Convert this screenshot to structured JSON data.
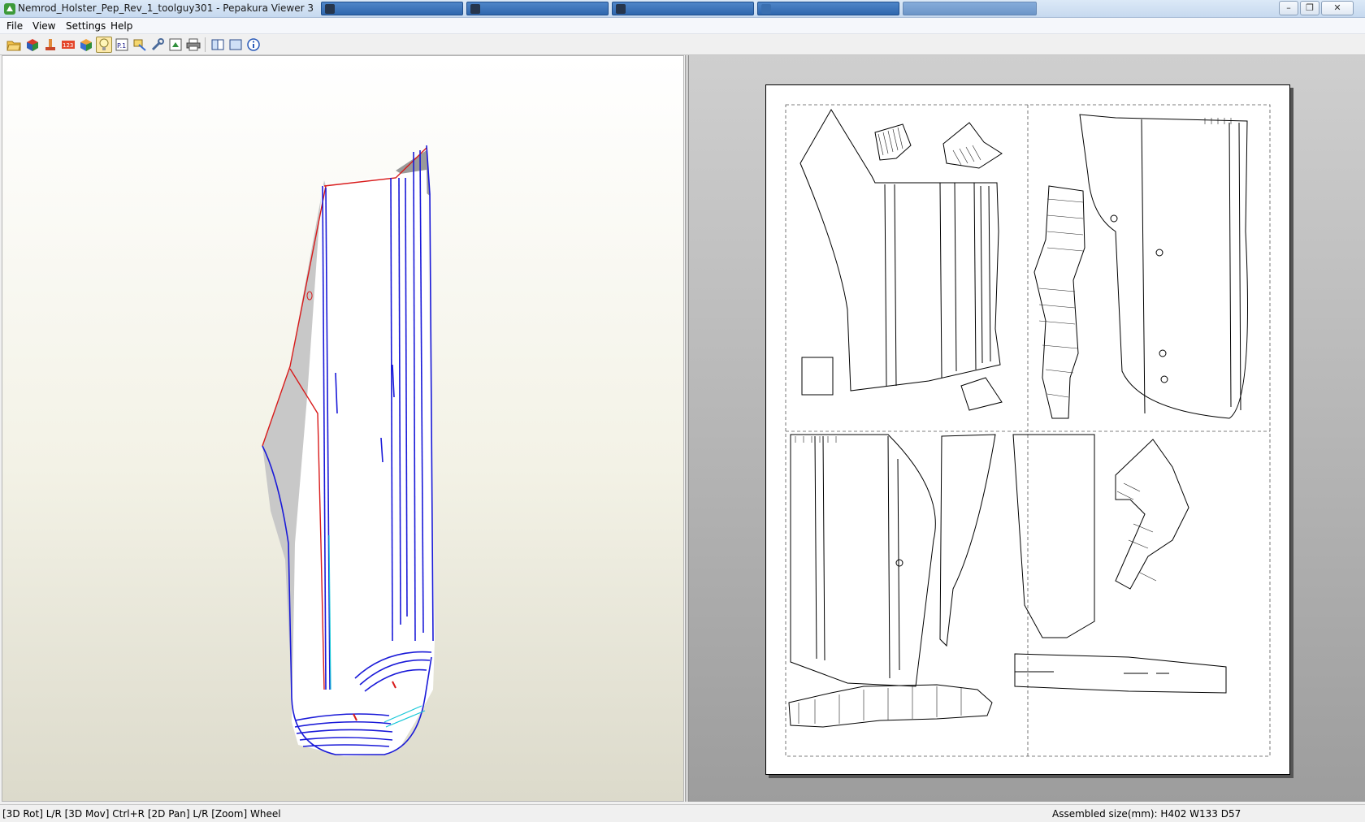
{
  "window": {
    "title": "Nemrod_Holster_Pep_Rev_1_toolguy301 - Pepakura Viewer 3",
    "app_icon": "pepakura-icon",
    "controls": [
      "minimize-icon",
      "restore-icon",
      "close-icon"
    ]
  },
  "menu": {
    "items": [
      {
        "label": "File"
      },
      {
        "label": "View"
      },
      {
        "label": "Settings"
      },
      {
        "label": "Help"
      }
    ]
  },
  "toolbar": {
    "tools": [
      {
        "icon": "open-folder-icon"
      },
      {
        "icon": "3d-model-icon"
      },
      {
        "icon": "flatten-icon"
      },
      {
        "icon": "numbering-icon"
      },
      {
        "icon": "cube-color-icon"
      },
      {
        "icon": "light-bulb-icon",
        "active": true
      },
      {
        "icon": "page-number-icon"
      },
      {
        "icon": "edge-settings-icon"
      },
      {
        "icon": "tools-icon"
      },
      {
        "icon": "export-icon"
      },
      {
        "icon": "print-icon"
      },
      {
        "icon": "split-view-icon"
      },
      {
        "icon": "single-view-icon"
      },
      {
        "icon": "info-icon"
      }
    ]
  },
  "status": {
    "left": "[3D Rot] L/R [3D Mov] Ctrl+R [2D Pan] L/R [Zoom] Wheel",
    "right": "Assembled size(mm): H402 W133 D57"
  },
  "colors": {
    "edge_blue": "#1a1ad8",
    "edge_red": "#d81a1a",
    "edge_cyan": "#18c8d8",
    "titlebar": "#c6d9ef",
    "background_2d": "#a8a8a8"
  }
}
